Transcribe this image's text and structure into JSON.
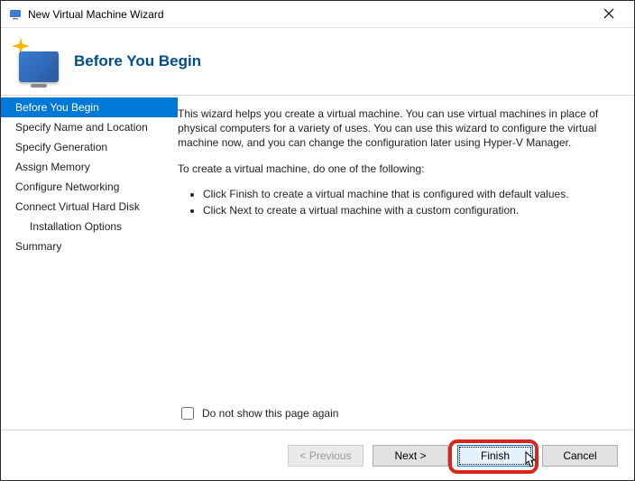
{
  "window": {
    "title": "New Virtual Machine Wizard"
  },
  "header": {
    "heading": "Before You Begin"
  },
  "sidebar": {
    "items": [
      {
        "label": "Before You Begin",
        "active": true
      },
      {
        "label": "Specify Name and Location"
      },
      {
        "label": "Specify Generation"
      },
      {
        "label": "Assign Memory"
      },
      {
        "label": "Configure Networking"
      },
      {
        "label": "Connect Virtual Hard Disk"
      },
      {
        "label": "Installation Options",
        "indent": true
      },
      {
        "label": "Summary"
      }
    ]
  },
  "content": {
    "intro": "This wizard helps you create a virtual machine. You can use virtual machines in place of physical computers for a variety of uses. You can use this wizard to configure the virtual machine now, and you can change the configuration later using Hyper-V Manager.",
    "instruction": "To create a virtual machine, do one of the following:",
    "bullets": [
      "Click Finish to create a virtual machine that is configured with default values.",
      "Click Next to create a virtual machine with a custom configuration."
    ],
    "dont_show_label": "Do not show this page again",
    "dont_show_checked": false
  },
  "footer": {
    "previous": "< Previous",
    "next": "Next >",
    "finish": "Finish",
    "cancel": "Cancel"
  }
}
